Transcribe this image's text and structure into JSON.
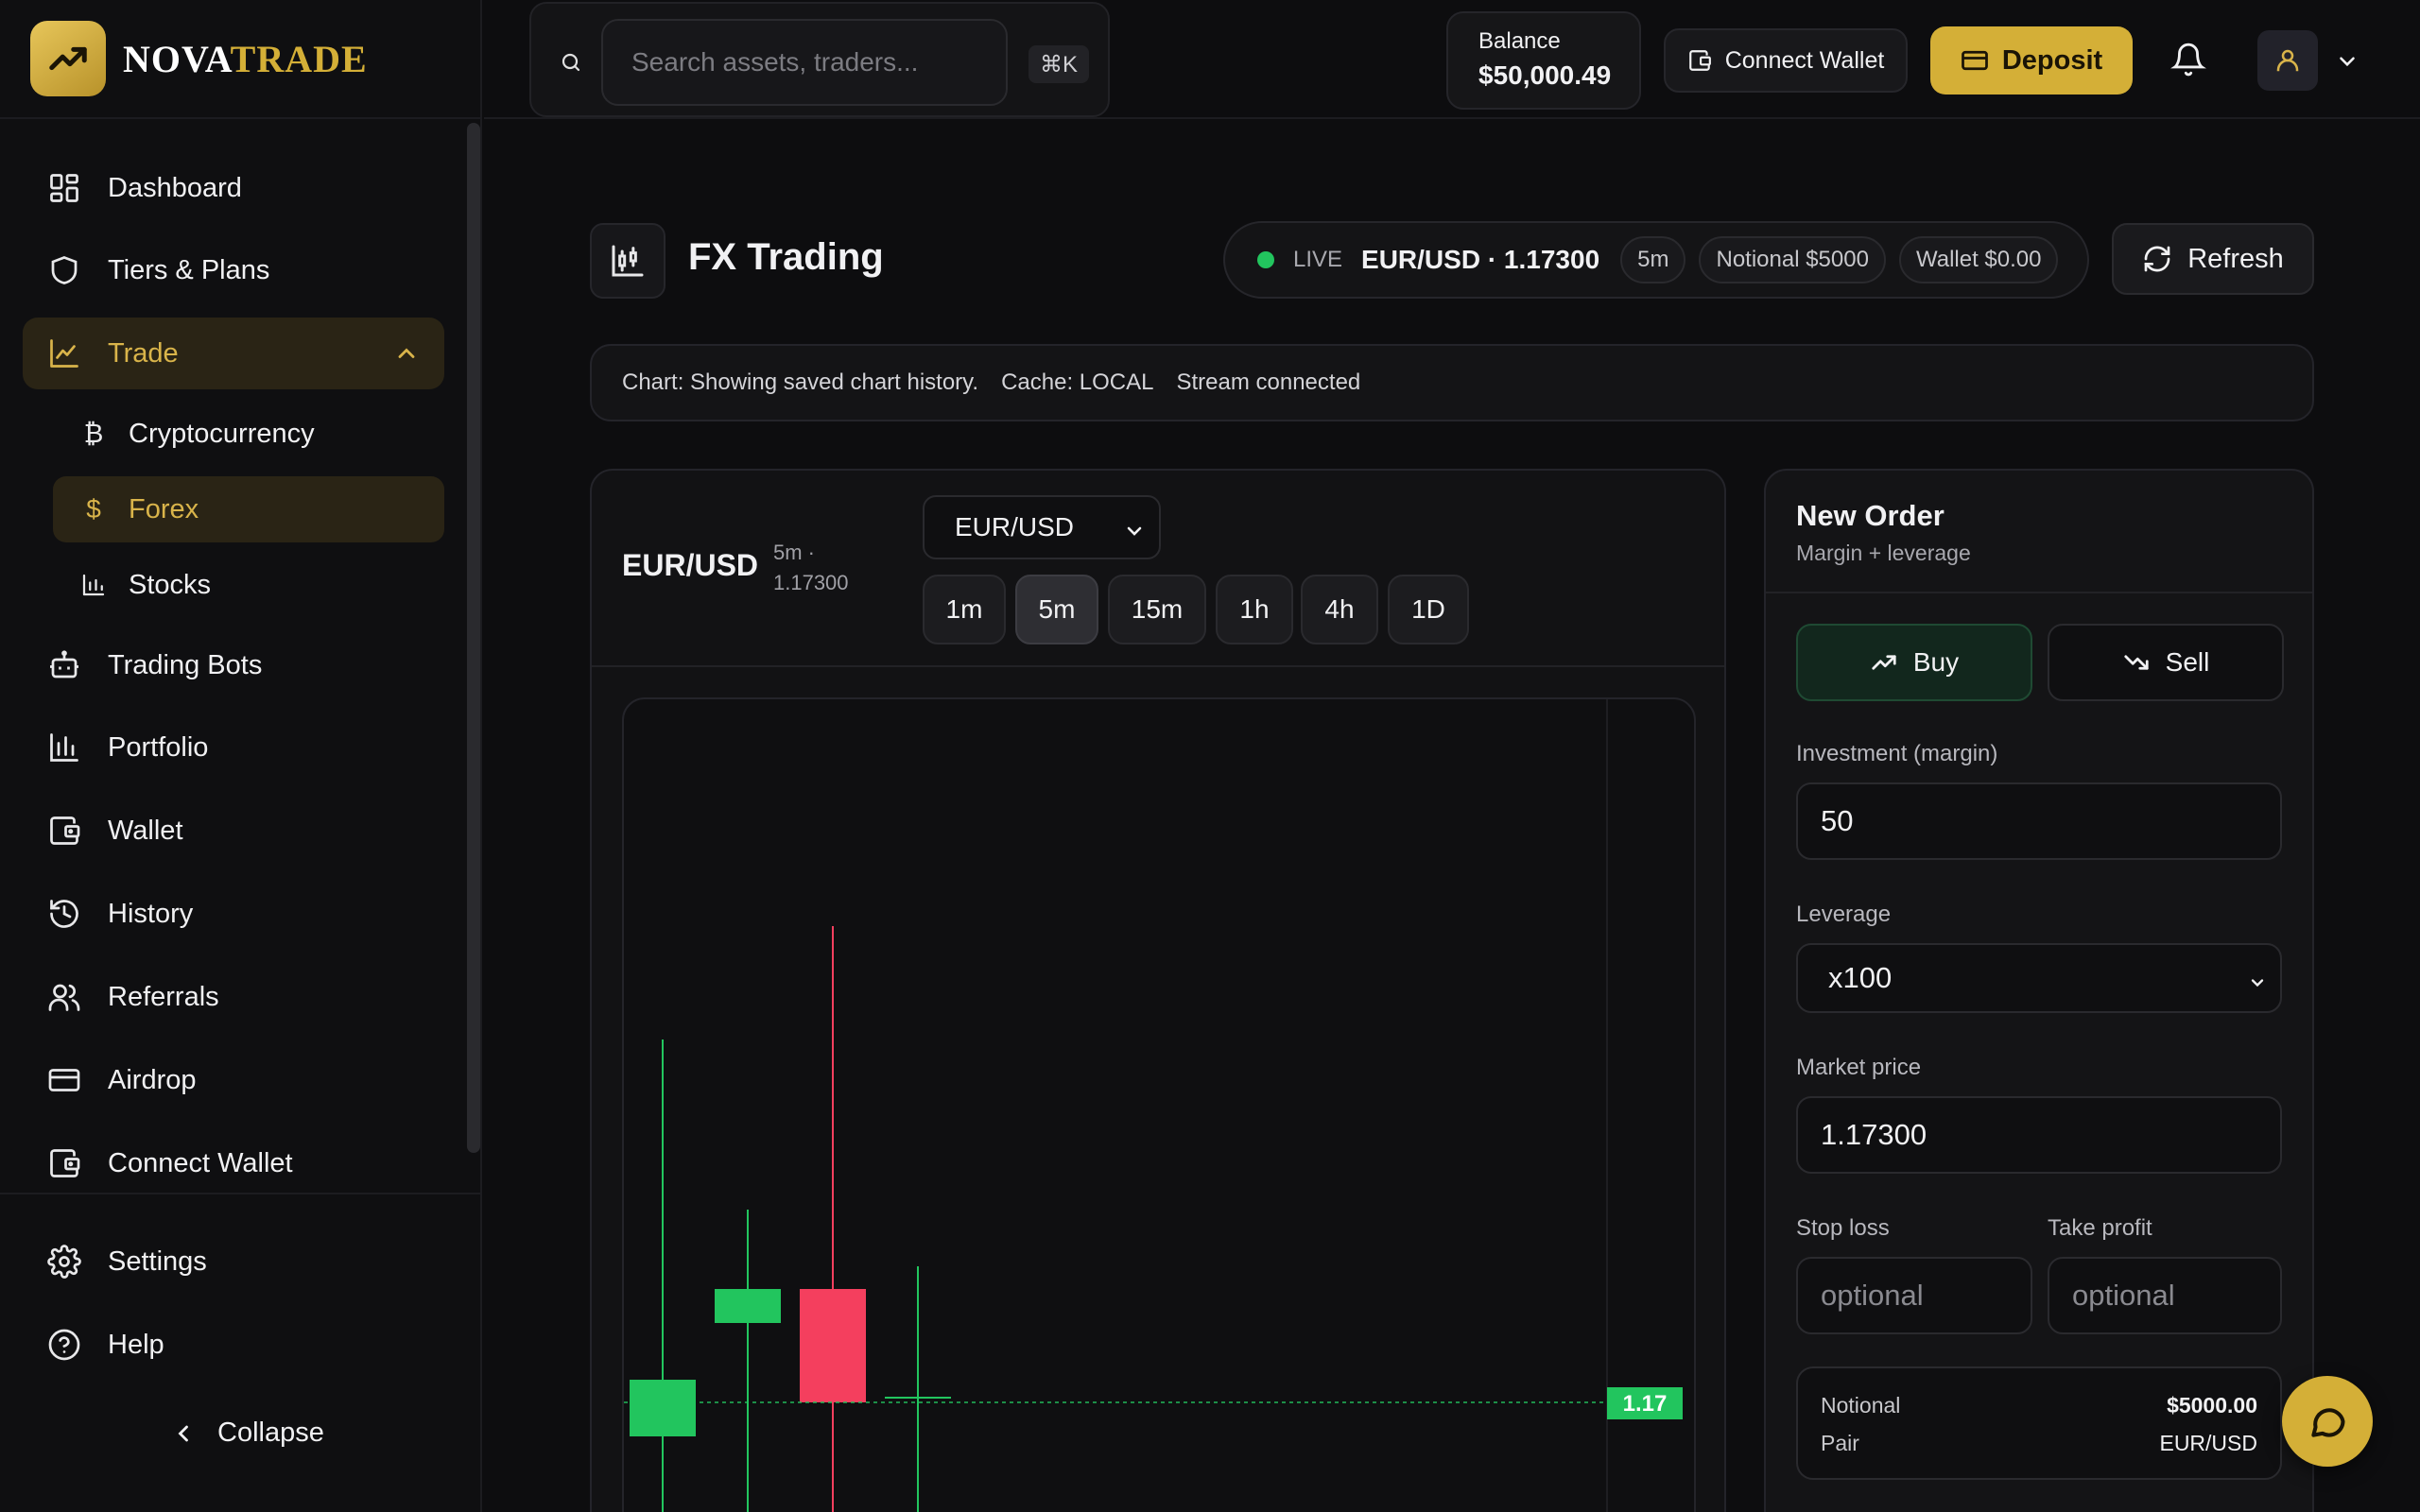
{
  "brand": {
    "name_part1": "NOVA",
    "name_part2": "TRADE"
  },
  "sidebar": {
    "items": [
      {
        "label": "Dashboard"
      },
      {
        "label": "Tiers & Plans"
      },
      {
        "label": "Trade"
      },
      {
        "label": "Cryptocurrency"
      },
      {
        "label": "Forex"
      },
      {
        "label": "Stocks"
      },
      {
        "label": "Trading Bots"
      },
      {
        "label": "Portfolio"
      },
      {
        "label": "Wallet"
      },
      {
        "label": "History"
      },
      {
        "label": "Referrals"
      },
      {
        "label": "Airdrop"
      },
      {
        "label": "Connect Wallet"
      },
      {
        "label": "Settings"
      },
      {
        "label": "Help"
      }
    ],
    "collapse_label": "Collapse"
  },
  "header": {
    "search_placeholder": "Search assets, traders...",
    "search_shortcut": "⌘K",
    "balance_label": "Balance",
    "balance_value": "$50,000.49",
    "connect_wallet_label": "Connect Wallet",
    "deposit_label": "Deposit"
  },
  "page": {
    "title": "FX Trading",
    "live_label": "LIVE",
    "live_pair": "EUR/USD · 1.17300",
    "chips": [
      "5m",
      "Notional $5000",
      "Wallet $0.00"
    ],
    "refresh_label": "Refresh",
    "info": [
      "Chart: Showing saved chart history.",
      "Cache: LOCAL",
      "Stream connected"
    ]
  },
  "chart_panel": {
    "pair": "EUR/USD",
    "meta_line1": "5m ·",
    "meta_line2": "1.17300",
    "pair_select_value": "EUR/USD",
    "timeframes": [
      "1m",
      "5m",
      "15m",
      "1h",
      "4h",
      "1D"
    ],
    "active_timeframe": "5m",
    "price_tag": "1.17"
  },
  "chart_data": {
    "type": "candlestick",
    "colors": {
      "up": "#22c55e",
      "down": "#f43f5e"
    },
    "candles": [
      {
        "open": 1.1695,
        "close": 1.17,
        "high": 1.173,
        "low": 1.169
      },
      {
        "open": 1.1705,
        "close": 1.1708,
        "high": 1.1715,
        "low": 1.169
      },
      {
        "open": 1.1708,
        "close": 1.1698,
        "high": 1.174,
        "low": 1.169
      },
      {
        "open": 1.16985,
        "close": 1.16985,
        "high": 1.171,
        "low": 1.169
      }
    ],
    "last_price": 1.1698,
    "last_price_label": "1.17"
  },
  "order": {
    "title": "New Order",
    "subtitle": "Margin + leverage",
    "buy_label": "Buy",
    "sell_label": "Sell",
    "investment_label": "Investment (margin)",
    "investment_value": "50",
    "leverage_label": "Leverage",
    "leverage_value": "x100",
    "market_price_label": "Market price",
    "market_price_value": "1.17300",
    "stop_loss_label": "Stop loss",
    "stop_loss_placeholder": "optional",
    "take_profit_label": "Take profit",
    "take_profit_placeholder": "optional",
    "summary": {
      "notional_label": "Notional",
      "notional_value": "$5000.00",
      "pair_label": "Pair",
      "pair_value": "EUR/USD"
    }
  }
}
